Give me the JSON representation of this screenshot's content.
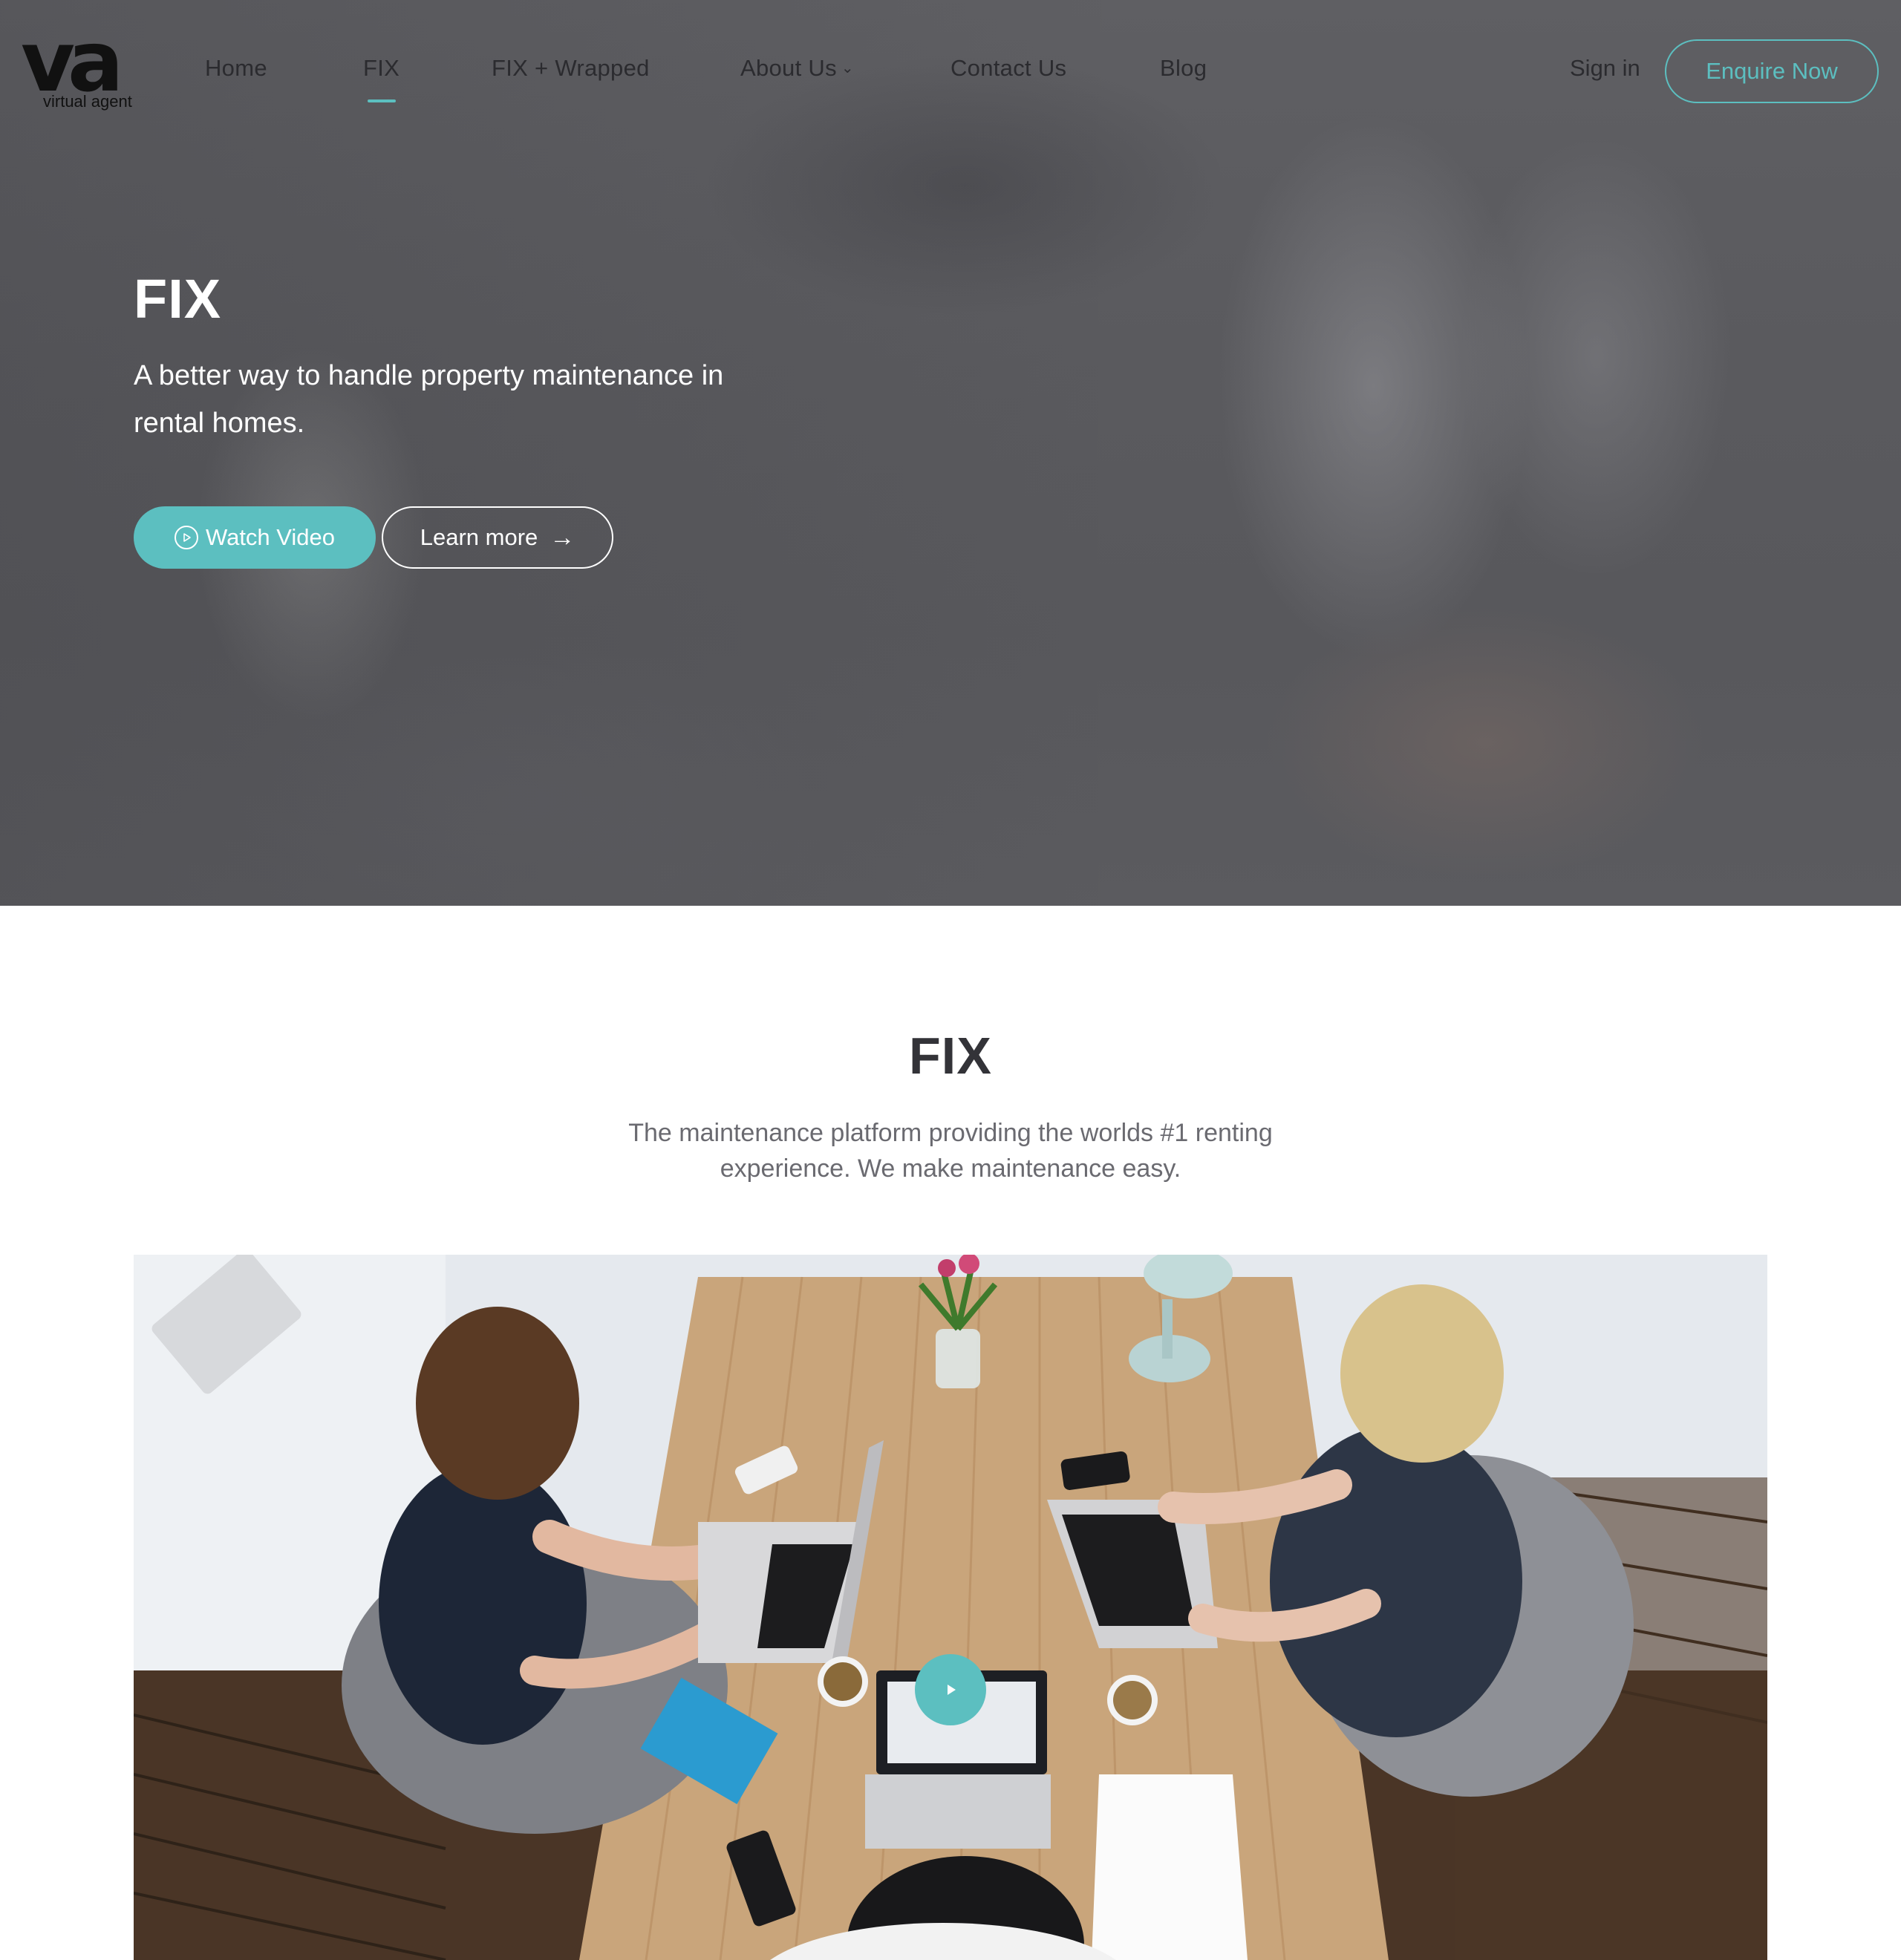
{
  "nav": {
    "logo_text": "va",
    "logo_subtext": "virtual agent",
    "links": [
      {
        "label": "Home"
      },
      {
        "label": "FIX",
        "active": true
      },
      {
        "label": "FIX + Wrapped"
      },
      {
        "label": "About Us",
        "has_dropdown": true
      },
      {
        "label": "Contact Us"
      },
      {
        "label": "Blog"
      }
    ],
    "sign_in": "Sign in",
    "cta": "Enquire Now"
  },
  "hero": {
    "title": "FIX",
    "subtitle": "A better way to handle property maintenance in rental homes.",
    "watch_video": "Watch Video",
    "learn_more": "Learn more",
    "play_icon": "play-circle-icon",
    "arrow_icon": "arrow-right-icon"
  },
  "section": {
    "title": "FIX",
    "subtitle": "The maintenance platform providing the worlds #1 renting experience. We make maintenance easy.",
    "photo_play_icon": "play-icon"
  },
  "colors": {
    "accent": "#5cbfc0",
    "nav_text": "#2b2b2f",
    "heading": "#333338",
    "body_text": "#6a6a70"
  }
}
